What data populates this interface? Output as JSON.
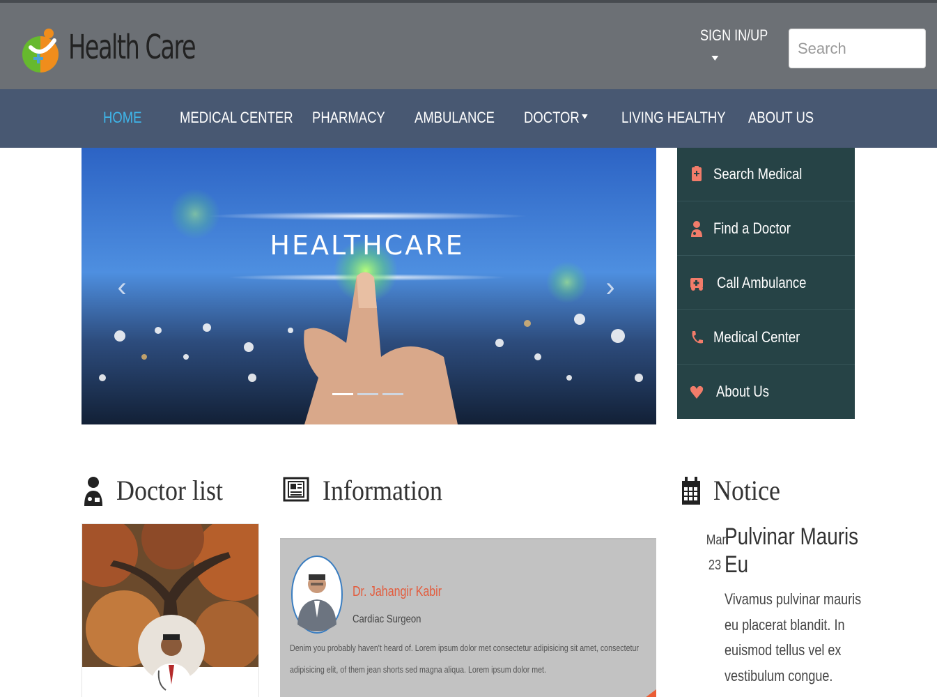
{
  "header": {
    "logo_text": "Health Care",
    "signin_label": "SIGN IN/UP",
    "search_placeholder": "Search"
  },
  "nav": {
    "items": [
      {
        "label": "HOME",
        "active": true
      },
      {
        "label": "MEDICAL CENTER"
      },
      {
        "label": "PHARMACY"
      },
      {
        "label": "AMBULANCE"
      },
      {
        "label": "DOCTOR",
        "has_caret": true
      },
      {
        "label": "LIVING HEALTHY"
      },
      {
        "label": "ABOUT US"
      }
    ]
  },
  "hero": {
    "headline": "HEALTHCARE",
    "prev_icon": "chevron-left-icon",
    "next_icon": "chevron-right-icon",
    "slides": 3,
    "active_slide": 1
  },
  "quick_menu": {
    "items": [
      {
        "label": "Search Medical",
        "icon": "medical-file-icon"
      },
      {
        "label": "Find a Doctor",
        "icon": "doctor-icon"
      },
      {
        "label": "Call Ambulance",
        "icon": "ambulance-icon"
      },
      {
        "label": "Medical Center",
        "icon": "phone-icon"
      },
      {
        "label": "About Us",
        "icon": "heart-icon"
      }
    ]
  },
  "sections": {
    "doctor_list": {
      "title": "Doctor list",
      "icon": "doctor-icon"
    },
    "information": {
      "title": "Information",
      "icon": "newspaper-icon"
    },
    "notice": {
      "title": "Notice",
      "icon": "calendar-icon"
    }
  },
  "information_card": {
    "name": "Dr. Jahangir Kabir",
    "role": "Cardiac Surgeon",
    "text": "Denim you probably haven't heard of. Lorem ipsum dolor met consectetur adipisicing sit amet, consectetur adipisicing elit, of them jean shorts sed magna aliqua. Lorem ipsum dolor met."
  },
  "notice_item": {
    "month": "Mar",
    "day": "23",
    "title": "Pulvinar Mauris Eu",
    "body": "Vivamus pulvinar mauris eu placerat blandit. In euismod tellus vel ex vestibulum congue."
  },
  "colors": {
    "header_bg": "#6c7075",
    "nav_bg": "#485872",
    "nav_active": "#3fb6ea",
    "quick_menu_bg": "#264346",
    "icon_accent": "#f27c6a",
    "doctor_name": "#e35b3c"
  }
}
